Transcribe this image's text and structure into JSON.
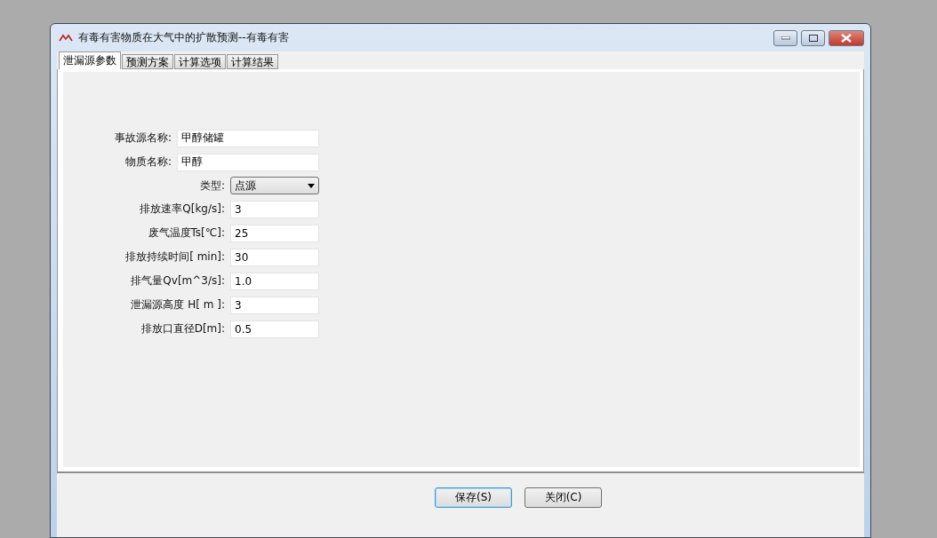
{
  "window": {
    "title": "有毒有害物质在大气中的扩散预测--有毒有害"
  },
  "tabs": [
    {
      "label": "泄漏源参数",
      "selected": true
    },
    {
      "label": "预测方案",
      "selected": false
    },
    {
      "label": "计算选项",
      "selected": false
    },
    {
      "label": "计算结果",
      "selected": false
    }
  ],
  "fields": [
    {
      "kind": "wide",
      "label": "事故源名称:",
      "value": "甲醇储罐"
    },
    {
      "kind": "wide",
      "label": "物质名称:",
      "value": "甲醇"
    },
    {
      "kind": "select",
      "label": "类型:",
      "value": "点源"
    },
    {
      "kind": "text",
      "label": "排放速率Q[kg/s]:",
      "value": "3"
    },
    {
      "kind": "text",
      "label": "废气温度Ts[℃]:",
      "value": "25"
    },
    {
      "kind": "text",
      "label": "排放持续时间[ min]:",
      "value": "30"
    },
    {
      "kind": "text",
      "label": "排气量Qv[m^3/s]:",
      "value": "1.0"
    },
    {
      "kind": "text",
      "label": "泄漏源高度 H[  m ]:",
      "value": "3"
    },
    {
      "kind": "text",
      "label": "排放口直径D[m]:",
      "value": "0.5"
    }
  ],
  "buttons": [
    {
      "label": "保存(S)",
      "selected": true
    },
    {
      "label": "关闭(C)",
      "selected": false
    }
  ]
}
